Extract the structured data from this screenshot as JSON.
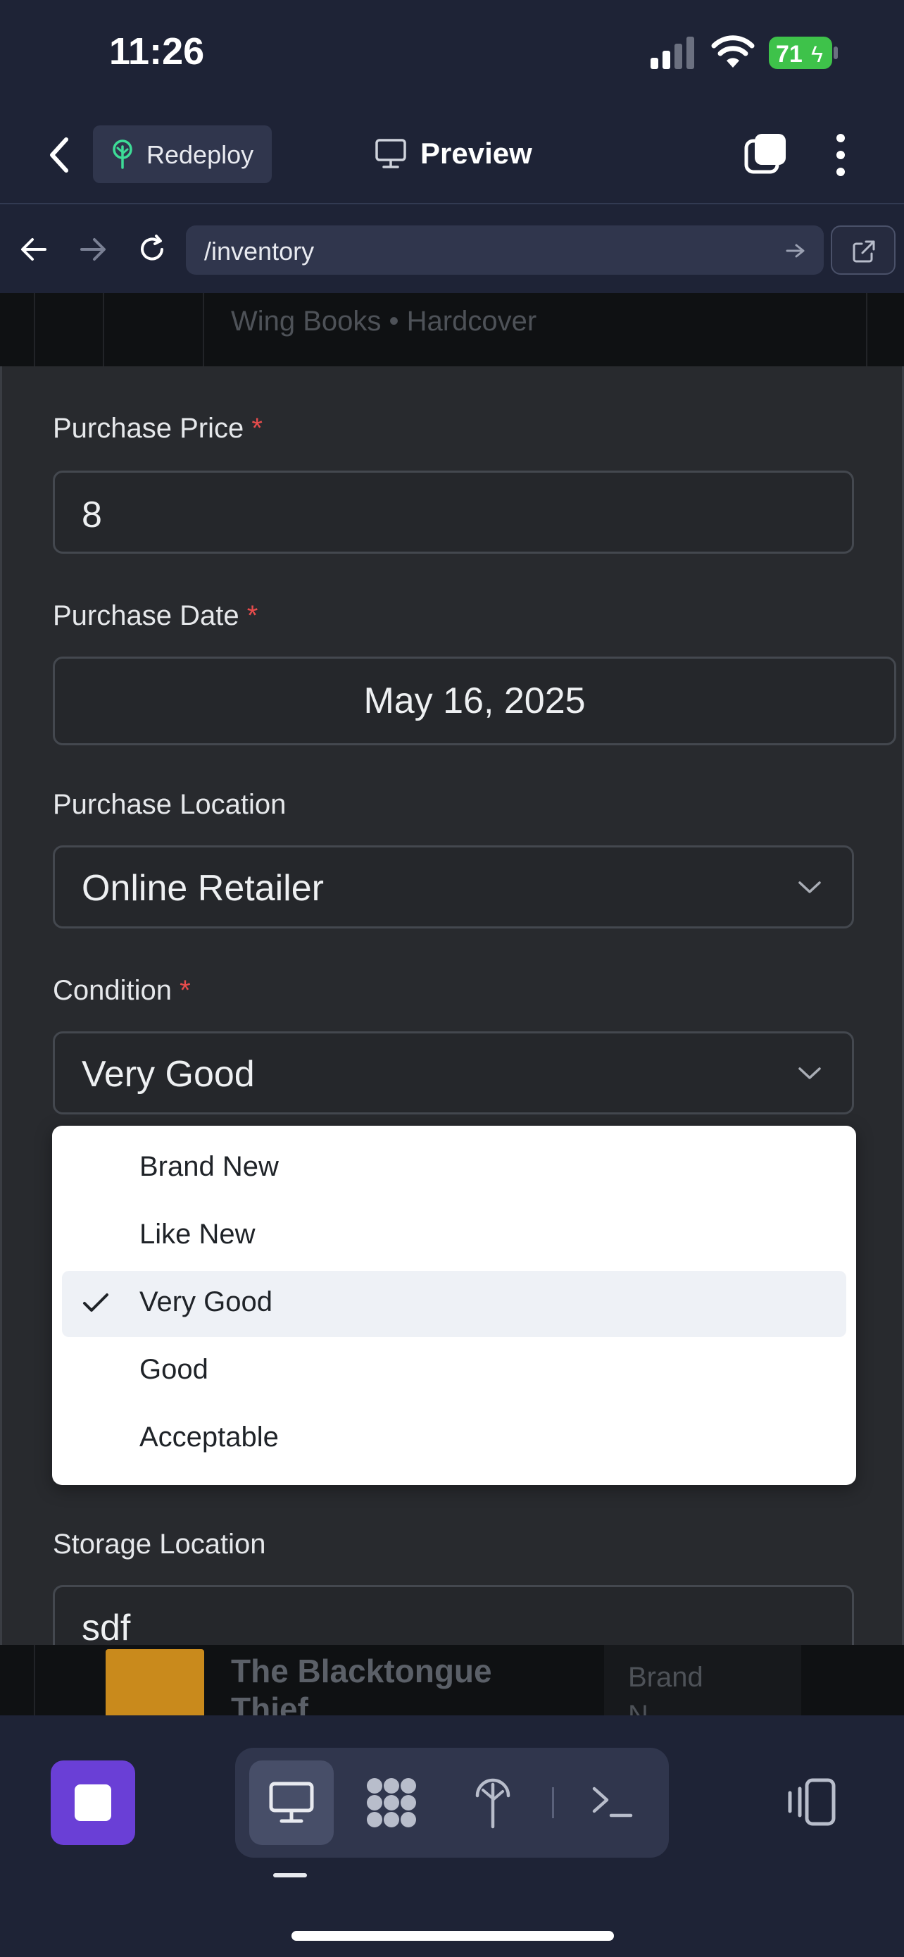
{
  "status_bar": {
    "time": "11:26",
    "battery": "71"
  },
  "top_nav": {
    "redeploy_label": "Redeploy",
    "preview_label": "Preview"
  },
  "browser": {
    "url": "/inventory"
  },
  "page_strip": {
    "text": "Wing Books • Hardcover"
  },
  "form": {
    "purchase_price": {
      "label": "Purchase Price",
      "required": "*",
      "value": "8"
    },
    "purchase_date": {
      "label": "Purchase Date",
      "required": "*",
      "value": "May 16, 2025"
    },
    "purchase_location": {
      "label": "Purchase Location",
      "value": "Online Retailer"
    },
    "condition": {
      "label": "Condition",
      "required": "*",
      "value": "Very Good",
      "options": [
        "Brand New",
        "Like New",
        "Very Good",
        "Good",
        "Acceptable"
      ],
      "selected": "Very Good"
    },
    "storage_location": {
      "label": "Storage Location",
      "value": "sdf"
    }
  },
  "bottom_peek": {
    "book_title_line1": "The Blacktongue",
    "book_title_line2": "Thief",
    "condition_col_line1": "Brand",
    "condition_col_line2": "N"
  },
  "colors": {
    "accent_purple": "#6a3fd6",
    "redeploy_icon": "#3ddc97",
    "battery_green": "#3ec24a",
    "required_red": "#e74c4c"
  }
}
